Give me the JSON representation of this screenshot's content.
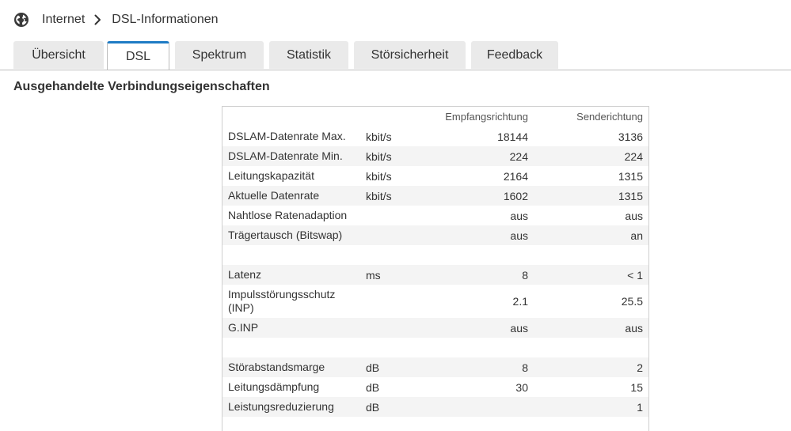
{
  "breadcrumb": {
    "icon": "globe-icon",
    "items": [
      "Internet",
      "DSL-Informationen"
    ]
  },
  "tabs": [
    {
      "label": "Übersicht",
      "active": false
    },
    {
      "label": "DSL",
      "active": true
    },
    {
      "label": "Spektrum",
      "active": false
    },
    {
      "label": "Statistik",
      "active": false
    },
    {
      "label": "Störsicherheit",
      "active": false
    },
    {
      "label": "Feedback",
      "active": false
    }
  ],
  "colors": {
    "active_tab_accent": "#1e7bc4",
    "tab_background": "#eaeaea",
    "row_shade": "#f4f4f4"
  },
  "section": {
    "title": "Ausgehandelte Verbindungseigenschaften"
  },
  "table": {
    "headers": {
      "label": "",
      "unit": "",
      "rx": "Empfangsrichtung",
      "tx": "Senderichtung"
    },
    "rows": [
      {
        "label": "DSLAM-Datenrate Max.",
        "unit": "kbit/s",
        "rx": "18144",
        "tx": "3136"
      },
      {
        "label": "DSLAM-Datenrate Min.",
        "unit": "kbit/s",
        "rx": "224",
        "tx": "224"
      },
      {
        "label": "Leitungskapazität",
        "unit": "kbit/s",
        "rx": "2164",
        "tx": "1315"
      },
      {
        "label": "Aktuelle Datenrate",
        "unit": "kbit/s",
        "rx": "1602",
        "tx": "1315"
      },
      {
        "label": "Nahtlose Ratenadaption",
        "unit": "",
        "rx": "aus",
        "tx": "aus"
      },
      {
        "label": "Trägertausch (Bitswap)",
        "unit": "",
        "rx": "aus",
        "tx": "an"
      },
      {
        "label": "",
        "unit": "",
        "rx": "",
        "tx": ""
      },
      {
        "label": "Latenz",
        "unit": "ms",
        "rx": "8",
        "tx": "< 1"
      },
      {
        "label": "Impulsstörungsschutz (INP)",
        "unit": "",
        "rx": "2.1",
        "tx": "25.5"
      },
      {
        "label": "G.INP",
        "unit": "",
        "rx": "aus",
        "tx": "aus"
      },
      {
        "label": "",
        "unit": "",
        "rx": "",
        "tx": ""
      },
      {
        "label": "Störabstandsmarge",
        "unit": "dB",
        "rx": "8",
        "tx": "2"
      },
      {
        "label": "Leitungsdämpfung",
        "unit": "dB",
        "rx": "30",
        "tx": "15"
      },
      {
        "label": "Leistungsreduzierung",
        "unit": "dB",
        "rx": "",
        "tx": "1"
      }
    ]
  }
}
